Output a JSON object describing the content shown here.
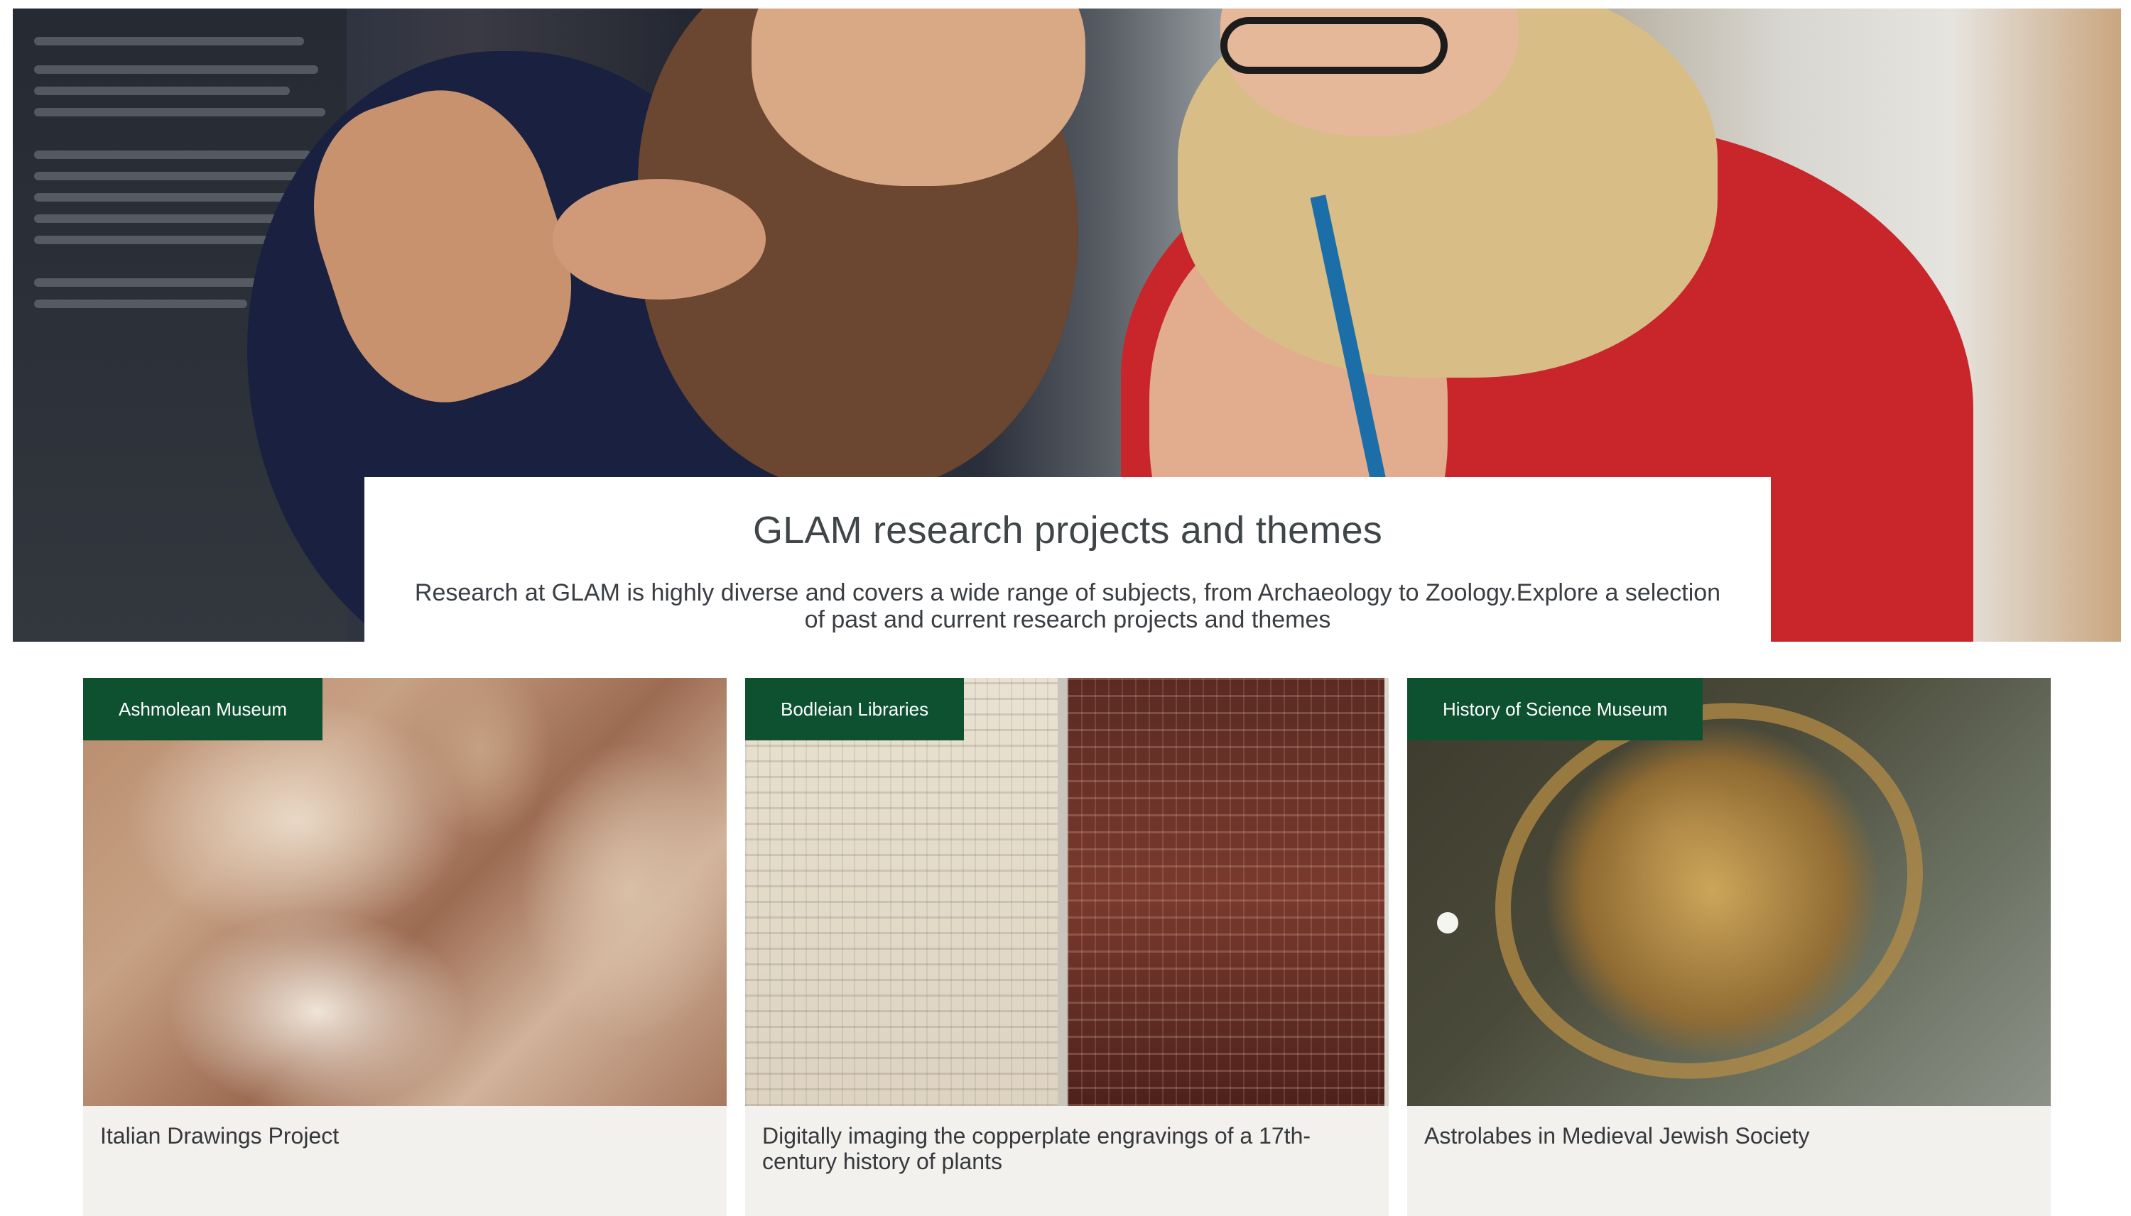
{
  "hero": {
    "title": "GLAM research projects and themes",
    "description": "Research at GLAM is highly diverse and covers a wide range of subjects, from Archaeology to Zoology.Explore a selection of past and current research projects and themes"
  },
  "cards": [
    {
      "tag": "Ashmolean Museum",
      "title": "Italian Drawings Project"
    },
    {
      "tag": "Bodleian Libraries",
      "title": "Digitally imaging the copperplate engravings of a 17th-century history of plants"
    },
    {
      "tag": "History of Science Museum",
      "title": "Astrolabes in Medieval Jewish Society"
    }
  ],
  "colors": {
    "tag_background": "#0d5130",
    "card_background": "#f3f1ee",
    "heading_text": "#404548"
  }
}
